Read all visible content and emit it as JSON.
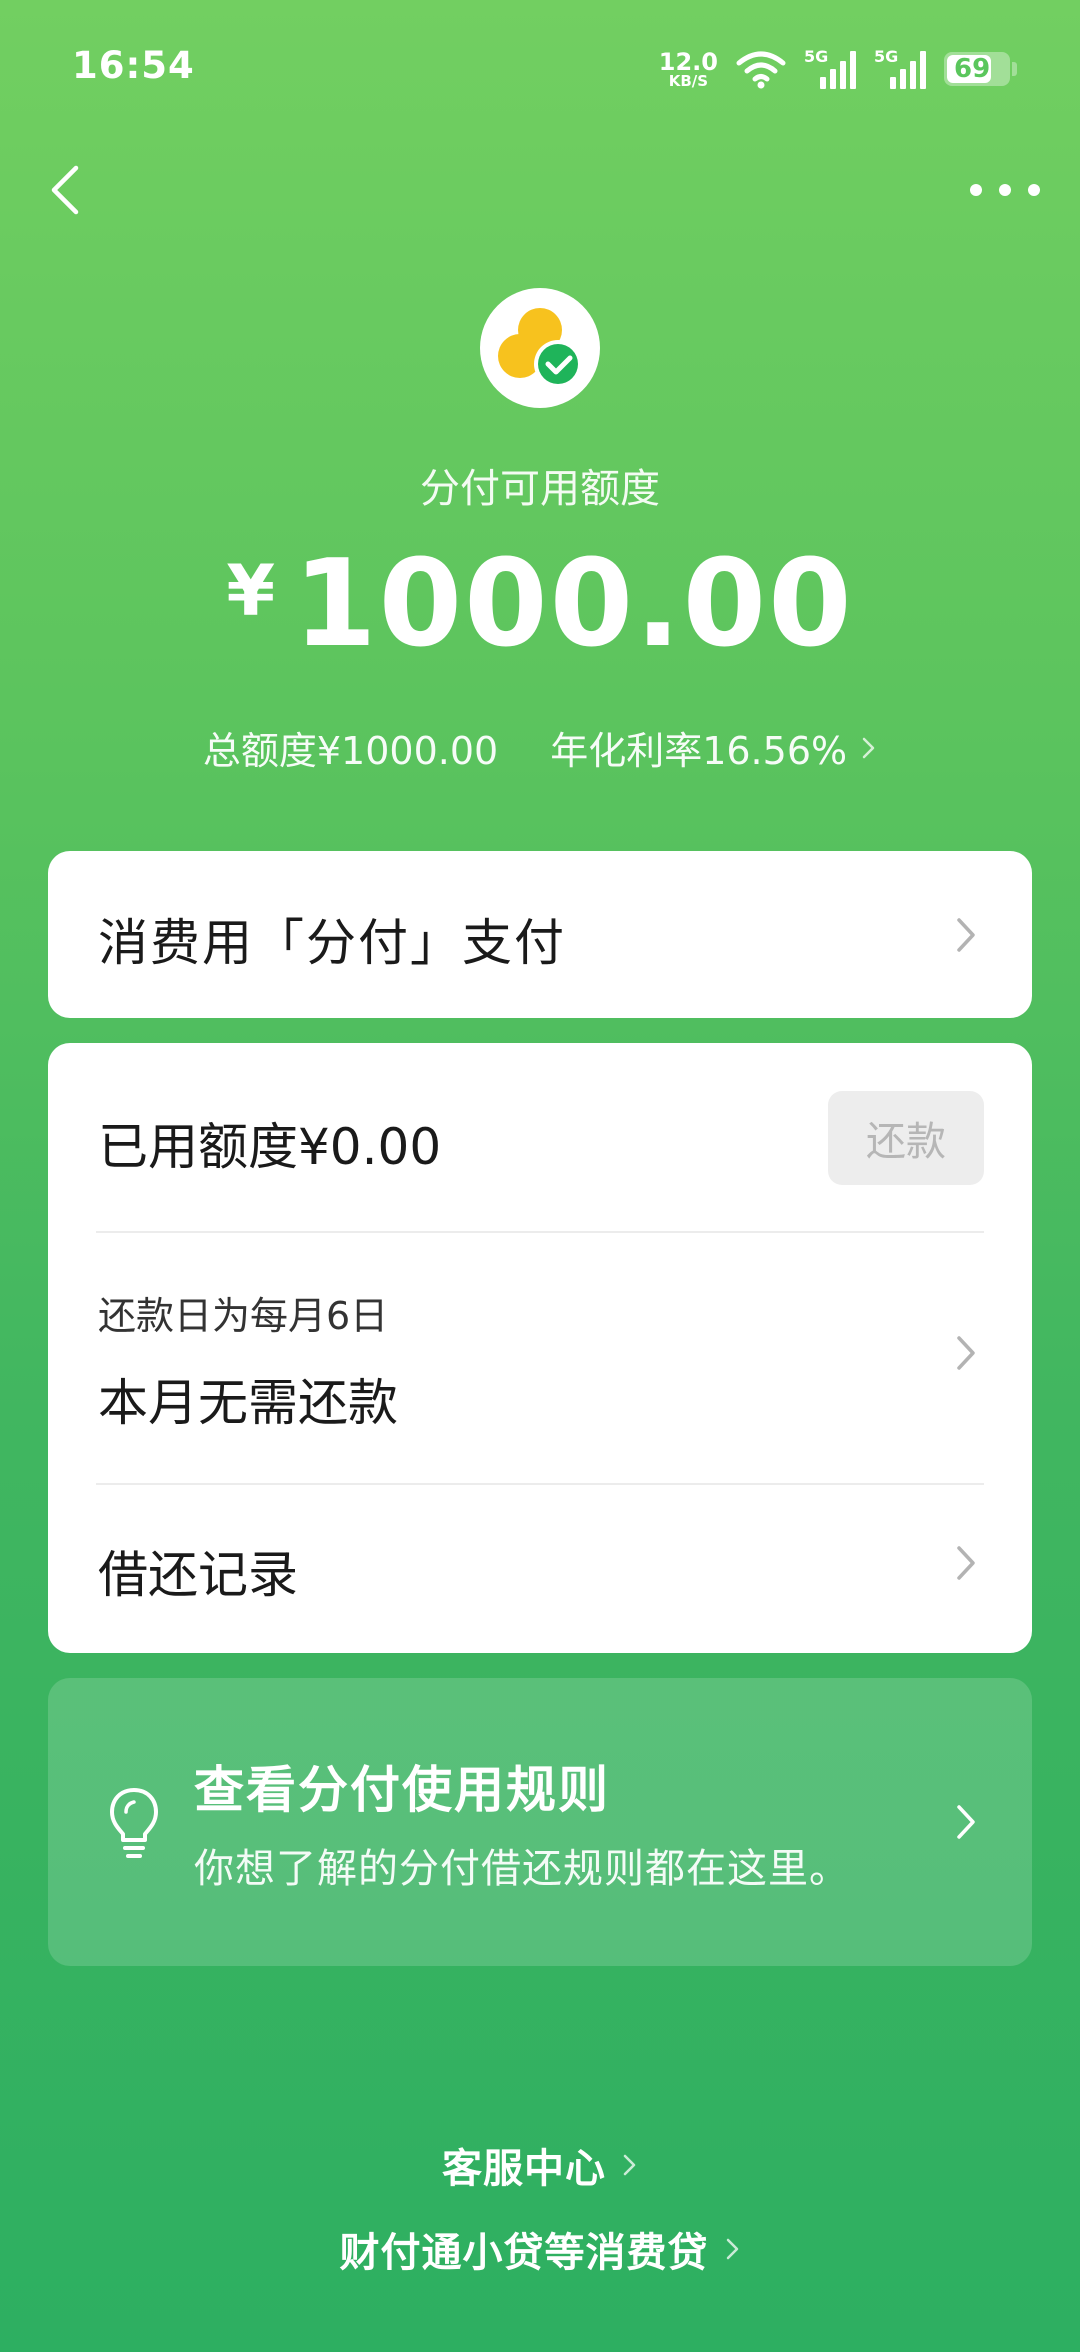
{
  "status_bar": {
    "time": "16:54",
    "net_speed_value": "12.0",
    "net_speed_unit": "KB/S",
    "sim1": "5G",
    "sim2": "5G",
    "battery": "69"
  },
  "header": {
    "available_label": "分付可用额度",
    "currency": "¥",
    "available_amount": "1000.00",
    "total_limit": "总额度¥1000.00",
    "annual_rate": "年化利率16.56%"
  },
  "pay_card": {
    "label": "消费用「分付」支付"
  },
  "repayment_card": {
    "used_amount": "已用额度¥0.00",
    "repay_button": "还款",
    "due_date": "还款日为每月6日",
    "status": "本月无需还款",
    "records": "借还记录"
  },
  "rules_card": {
    "title": "查看分付使用规则",
    "subtitle": "你想了解的分付借还规则都在这里。"
  },
  "footer": {
    "service_center": "客服中心",
    "loan_info": "财付通小贷等消费贷"
  },
  "colors": {
    "brand_green": "#2daf61",
    "top_green": "#72cf61",
    "logo_yellow": "#f7c21e",
    "check_green": "#1fb45a"
  }
}
